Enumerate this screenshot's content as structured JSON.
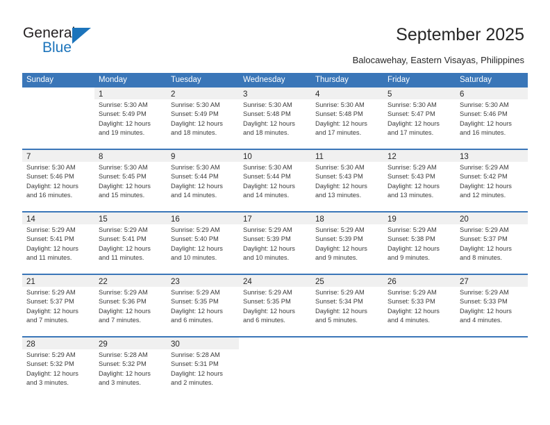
{
  "brand": {
    "name_top": "General",
    "name_bottom": "Blue",
    "accent_color": "#1c74bb"
  },
  "header": {
    "title": "September 2025",
    "subtitle": "Balocawehay, Eastern Visayas, Philippines"
  },
  "calendar": {
    "header_color": "#3a76b8",
    "weekdays": [
      "Sunday",
      "Monday",
      "Tuesday",
      "Wednesday",
      "Thursday",
      "Friday",
      "Saturday"
    ],
    "weeks": [
      [
        {
          "day": "",
          "sunrise": "",
          "sunset": "",
          "daylight_1": "",
          "daylight_2": ""
        },
        {
          "day": "1",
          "sunrise": "Sunrise: 5:30 AM",
          "sunset": "Sunset: 5:49 PM",
          "daylight_1": "Daylight: 12 hours",
          "daylight_2": "and 19 minutes."
        },
        {
          "day": "2",
          "sunrise": "Sunrise: 5:30 AM",
          "sunset": "Sunset: 5:49 PM",
          "daylight_1": "Daylight: 12 hours",
          "daylight_2": "and 18 minutes."
        },
        {
          "day": "3",
          "sunrise": "Sunrise: 5:30 AM",
          "sunset": "Sunset: 5:48 PM",
          "daylight_1": "Daylight: 12 hours",
          "daylight_2": "and 18 minutes."
        },
        {
          "day": "4",
          "sunrise": "Sunrise: 5:30 AM",
          "sunset": "Sunset: 5:48 PM",
          "daylight_1": "Daylight: 12 hours",
          "daylight_2": "and 17 minutes."
        },
        {
          "day": "5",
          "sunrise": "Sunrise: 5:30 AM",
          "sunset": "Sunset: 5:47 PM",
          "daylight_1": "Daylight: 12 hours",
          "daylight_2": "and 17 minutes."
        },
        {
          "day": "6",
          "sunrise": "Sunrise: 5:30 AM",
          "sunset": "Sunset: 5:46 PM",
          "daylight_1": "Daylight: 12 hours",
          "daylight_2": "and 16 minutes."
        }
      ],
      [
        {
          "day": "7",
          "sunrise": "Sunrise: 5:30 AM",
          "sunset": "Sunset: 5:46 PM",
          "daylight_1": "Daylight: 12 hours",
          "daylight_2": "and 16 minutes."
        },
        {
          "day": "8",
          "sunrise": "Sunrise: 5:30 AM",
          "sunset": "Sunset: 5:45 PM",
          "daylight_1": "Daylight: 12 hours",
          "daylight_2": "and 15 minutes."
        },
        {
          "day": "9",
          "sunrise": "Sunrise: 5:30 AM",
          "sunset": "Sunset: 5:44 PM",
          "daylight_1": "Daylight: 12 hours",
          "daylight_2": "and 14 minutes."
        },
        {
          "day": "10",
          "sunrise": "Sunrise: 5:30 AM",
          "sunset": "Sunset: 5:44 PM",
          "daylight_1": "Daylight: 12 hours",
          "daylight_2": "and 14 minutes."
        },
        {
          "day": "11",
          "sunrise": "Sunrise: 5:30 AM",
          "sunset": "Sunset: 5:43 PM",
          "daylight_1": "Daylight: 12 hours",
          "daylight_2": "and 13 minutes."
        },
        {
          "day": "12",
          "sunrise": "Sunrise: 5:29 AM",
          "sunset": "Sunset: 5:43 PM",
          "daylight_1": "Daylight: 12 hours",
          "daylight_2": "and 13 minutes."
        },
        {
          "day": "13",
          "sunrise": "Sunrise: 5:29 AM",
          "sunset": "Sunset: 5:42 PM",
          "daylight_1": "Daylight: 12 hours",
          "daylight_2": "and 12 minutes."
        }
      ],
      [
        {
          "day": "14",
          "sunrise": "Sunrise: 5:29 AM",
          "sunset": "Sunset: 5:41 PM",
          "daylight_1": "Daylight: 12 hours",
          "daylight_2": "and 11 minutes."
        },
        {
          "day": "15",
          "sunrise": "Sunrise: 5:29 AM",
          "sunset": "Sunset: 5:41 PM",
          "daylight_1": "Daylight: 12 hours",
          "daylight_2": "and 11 minutes."
        },
        {
          "day": "16",
          "sunrise": "Sunrise: 5:29 AM",
          "sunset": "Sunset: 5:40 PM",
          "daylight_1": "Daylight: 12 hours",
          "daylight_2": "and 10 minutes."
        },
        {
          "day": "17",
          "sunrise": "Sunrise: 5:29 AM",
          "sunset": "Sunset: 5:39 PM",
          "daylight_1": "Daylight: 12 hours",
          "daylight_2": "and 10 minutes."
        },
        {
          "day": "18",
          "sunrise": "Sunrise: 5:29 AM",
          "sunset": "Sunset: 5:39 PM",
          "daylight_1": "Daylight: 12 hours",
          "daylight_2": "and 9 minutes."
        },
        {
          "day": "19",
          "sunrise": "Sunrise: 5:29 AM",
          "sunset": "Sunset: 5:38 PM",
          "daylight_1": "Daylight: 12 hours",
          "daylight_2": "and 9 minutes."
        },
        {
          "day": "20",
          "sunrise": "Sunrise: 5:29 AM",
          "sunset": "Sunset: 5:37 PM",
          "daylight_1": "Daylight: 12 hours",
          "daylight_2": "and 8 minutes."
        }
      ],
      [
        {
          "day": "21",
          "sunrise": "Sunrise: 5:29 AM",
          "sunset": "Sunset: 5:37 PM",
          "daylight_1": "Daylight: 12 hours",
          "daylight_2": "and 7 minutes."
        },
        {
          "day": "22",
          "sunrise": "Sunrise: 5:29 AM",
          "sunset": "Sunset: 5:36 PM",
          "daylight_1": "Daylight: 12 hours",
          "daylight_2": "and 7 minutes."
        },
        {
          "day": "23",
          "sunrise": "Sunrise: 5:29 AM",
          "sunset": "Sunset: 5:35 PM",
          "daylight_1": "Daylight: 12 hours",
          "daylight_2": "and 6 minutes."
        },
        {
          "day": "24",
          "sunrise": "Sunrise: 5:29 AM",
          "sunset": "Sunset: 5:35 PM",
          "daylight_1": "Daylight: 12 hours",
          "daylight_2": "and 6 minutes."
        },
        {
          "day": "25",
          "sunrise": "Sunrise: 5:29 AM",
          "sunset": "Sunset: 5:34 PM",
          "daylight_1": "Daylight: 12 hours",
          "daylight_2": "and 5 minutes."
        },
        {
          "day": "26",
          "sunrise": "Sunrise: 5:29 AM",
          "sunset": "Sunset: 5:33 PM",
          "daylight_1": "Daylight: 12 hours",
          "daylight_2": "and 4 minutes."
        },
        {
          "day": "27",
          "sunrise": "Sunrise: 5:29 AM",
          "sunset": "Sunset: 5:33 PM",
          "daylight_1": "Daylight: 12 hours",
          "daylight_2": "and 4 minutes."
        }
      ],
      [
        {
          "day": "28",
          "sunrise": "Sunrise: 5:29 AM",
          "sunset": "Sunset: 5:32 PM",
          "daylight_1": "Daylight: 12 hours",
          "daylight_2": "and 3 minutes."
        },
        {
          "day": "29",
          "sunrise": "Sunrise: 5:28 AM",
          "sunset": "Sunset: 5:32 PM",
          "daylight_1": "Daylight: 12 hours",
          "daylight_2": "and 3 minutes."
        },
        {
          "day": "30",
          "sunrise": "Sunrise: 5:28 AM",
          "sunset": "Sunset: 5:31 PM",
          "daylight_1": "Daylight: 12 hours",
          "daylight_2": "and 2 minutes."
        },
        {
          "day": "",
          "sunrise": "",
          "sunset": "",
          "daylight_1": "",
          "daylight_2": ""
        },
        {
          "day": "",
          "sunrise": "",
          "sunset": "",
          "daylight_1": "",
          "daylight_2": ""
        },
        {
          "day": "",
          "sunrise": "",
          "sunset": "",
          "daylight_1": "",
          "daylight_2": ""
        },
        {
          "day": "",
          "sunrise": "",
          "sunset": "",
          "daylight_1": "",
          "daylight_2": ""
        }
      ]
    ]
  }
}
